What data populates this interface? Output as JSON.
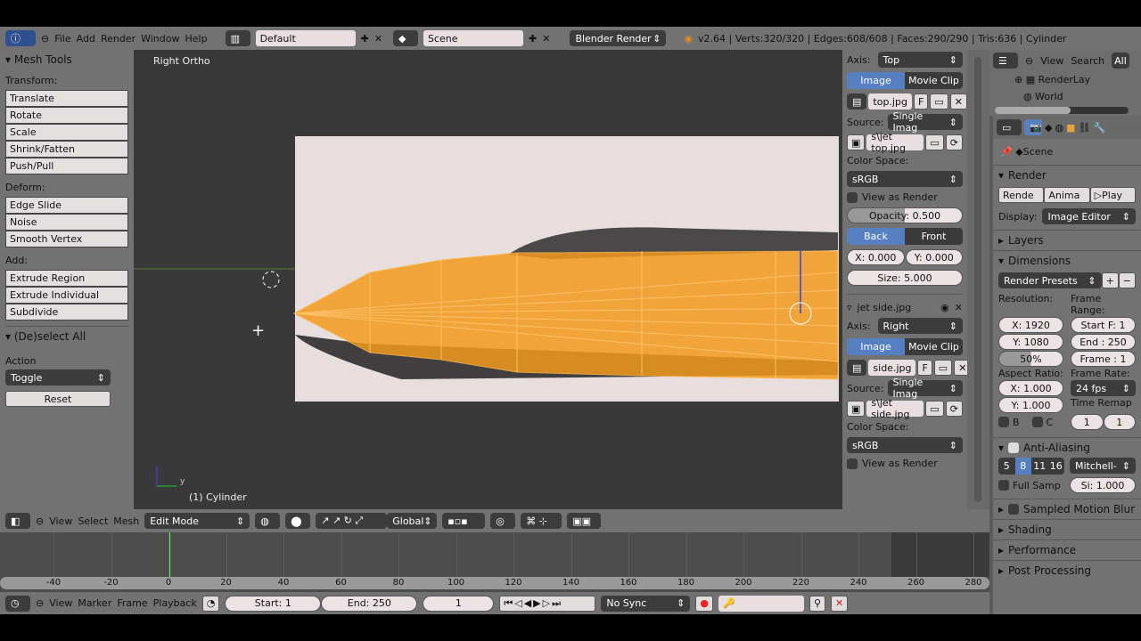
{
  "topbar": {
    "menus": [
      "File",
      "Add",
      "Render",
      "Window",
      "Help"
    ],
    "screen": "Default",
    "scene": "Scene",
    "engine": "Blender Render",
    "stats": "v2.64 | Verts:320/320 | Edges:608/608 | Faces:290/290 | Tris:636 | Cylinder"
  },
  "toolshelf": {
    "title": "Mesh Tools",
    "transform_label": "Transform:",
    "transform": [
      "Translate",
      "Rotate",
      "Scale",
      "Shrink/Fatten",
      "Push/Pull"
    ],
    "deform_label": "Deform:",
    "deform": [
      "Edge Slide",
      "Noise",
      "Smooth Vertex"
    ],
    "add_label": "Add:",
    "add": [
      "Extrude Region",
      "Extrude Individual",
      "Subdivide"
    ],
    "op_title": "(De)select All",
    "action_label": "Action",
    "action_value": "Toggle",
    "reset": "Reset"
  },
  "viewport": {
    "view_name": "Right Ortho",
    "object_label": "(1) Cylinder",
    "axis_y": "y"
  },
  "npanel": {
    "top": {
      "axis_label": "Axis:",
      "axis": "Top",
      "source_tabs": [
        "Image",
        "Movie Clip"
      ],
      "image": "top.jpg",
      "f": "F",
      "source_label": "Source:",
      "source": "Single Imag",
      "filepath": "s\\jet top.jpg",
      "colorspace_label": "Color Space:",
      "colorspace": "sRGB",
      "view_as_render": "View as Render",
      "opacity": "Opacity: 0.500",
      "order": [
        "Back",
        "Front"
      ],
      "x": "X: 0.000",
      "y": "Y: 0.000",
      "size": "Size: 5.000"
    },
    "side": {
      "title": "jet side.jpg",
      "axis_label": "Axis:",
      "axis": "Right",
      "source_tabs": [
        "Image",
        "Movie Clip"
      ],
      "image": "side.jpg",
      "f": "F",
      "source_label": "Source:",
      "source": "Single Imag",
      "filepath": "s\\jet side.jpg",
      "colorspace_label": "Color Space:",
      "colorspace": "sRGB",
      "view_as_render": "View as Render"
    }
  },
  "view_header": {
    "menus": [
      "View",
      "Select",
      "Mesh"
    ],
    "mode": "Edit Mode",
    "orientation": "Global"
  },
  "timeline": {
    "ticks": [
      "-40",
      "-20",
      "0",
      "20",
      "40",
      "60",
      "80",
      "100",
      "120",
      "140",
      "160",
      "180",
      "200",
      "220",
      "240",
      "260",
      "280"
    ],
    "current_frame": 1,
    "menus": [
      "View",
      "Marker",
      "Frame",
      "Playback"
    ],
    "start": "Start: 1",
    "end": "End: 250",
    "frame": "1",
    "sync": "No Sync"
  },
  "outliner": {
    "menus": [
      "View",
      "Search"
    ],
    "filter": "All",
    "items": [
      "RenderLay",
      "World"
    ]
  },
  "properties": {
    "context": "Scene",
    "render": {
      "title": "Render",
      "buttons": [
        "Rende",
        "Anima",
        "Play"
      ],
      "display_label": "Display:",
      "display": "Image Editor"
    },
    "layers": "Layers",
    "dimensions": {
      "title": "Dimensions",
      "presets": "Render Presets",
      "res_label": "Resolution:",
      "res_x": "X: 1920",
      "res_y": "Y: 1080",
      "res_pct": "50%",
      "fr_label": "Frame Range:",
      "start": "Start F: 1",
      "end": "End : 250",
      "frame": "Frame : 1",
      "aspect_label": "Aspect Ratio:",
      "ax": "X: 1.000",
      "ay": "Y: 1.000",
      "fps_label": "Frame Rate:",
      "fps": "24 fps",
      "remap_label": "Time Remap",
      "remap_old": "1",
      "remap_new": "1",
      "b": "B",
      "c": "C"
    },
    "aa": {
      "title": "Anti-Aliasing",
      "samples": [
        "5",
        "8",
        "11",
        "16"
      ],
      "filter": "Mitchell-",
      "full": "Full Samp",
      "size": "Si: 1.000"
    },
    "collapsed": [
      "Sampled Motion Blur",
      "Shading",
      "Performance",
      "Post Processing"
    ]
  },
  "colors": {
    "accent": "#5680c2",
    "mesh": "#f29a1e",
    "panel": "#727272",
    "viewport": "#393939"
  }
}
